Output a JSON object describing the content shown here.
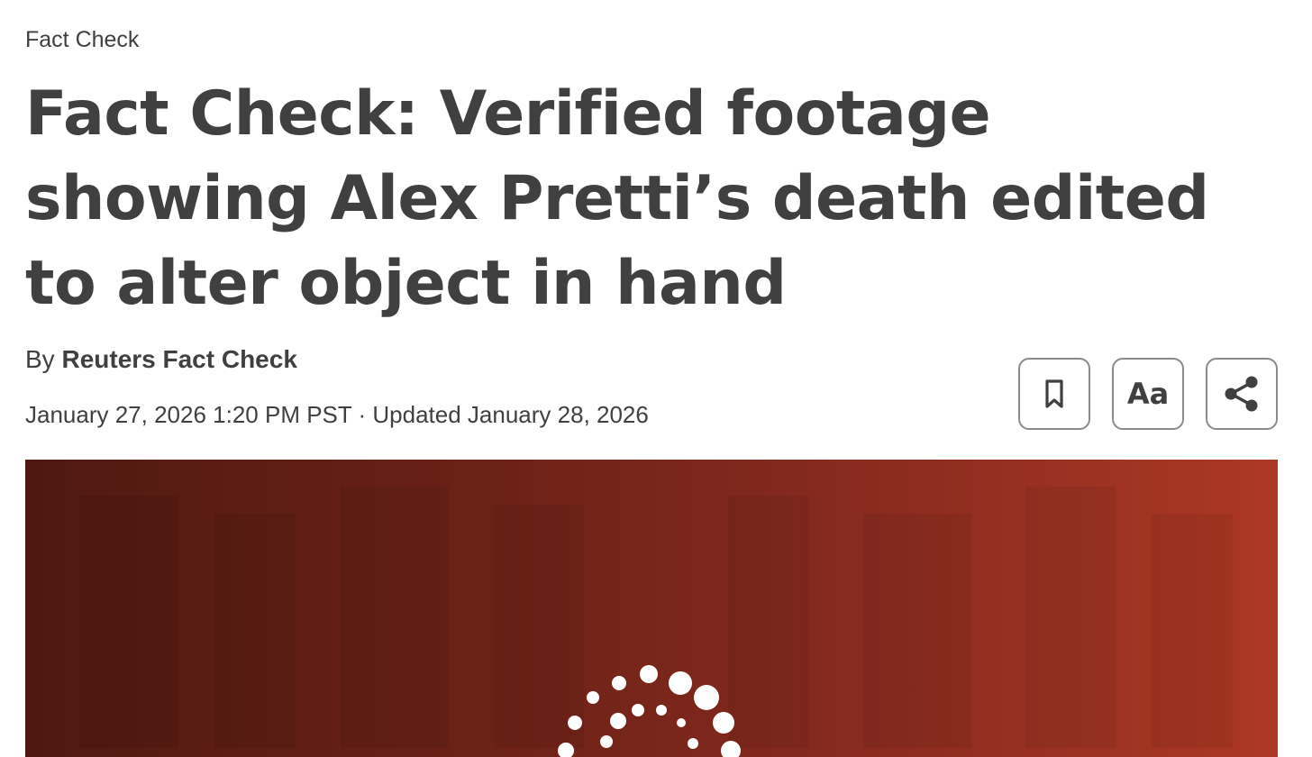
{
  "article": {
    "section": "Fact Check",
    "headline": "Fact Check: Verified footage showing Alex Pretti’s death edited to alter object in hand",
    "byline_prefix": "By",
    "author": "Reuters Fact Check",
    "dateline": "January 27, 2026 1:20 PM PST · Updated January 28, 2026"
  },
  "tools": {
    "text_size_label": "Aa"
  },
  "icons": {
    "bookmark": "bookmark-icon",
    "text_size": "text-size-icon",
    "share": "share-icon",
    "hero_logo": "reuters-dot-logo"
  },
  "colors": {
    "text": "#404040",
    "hero_start": "#4e1912",
    "hero_end": "#ad3825"
  }
}
